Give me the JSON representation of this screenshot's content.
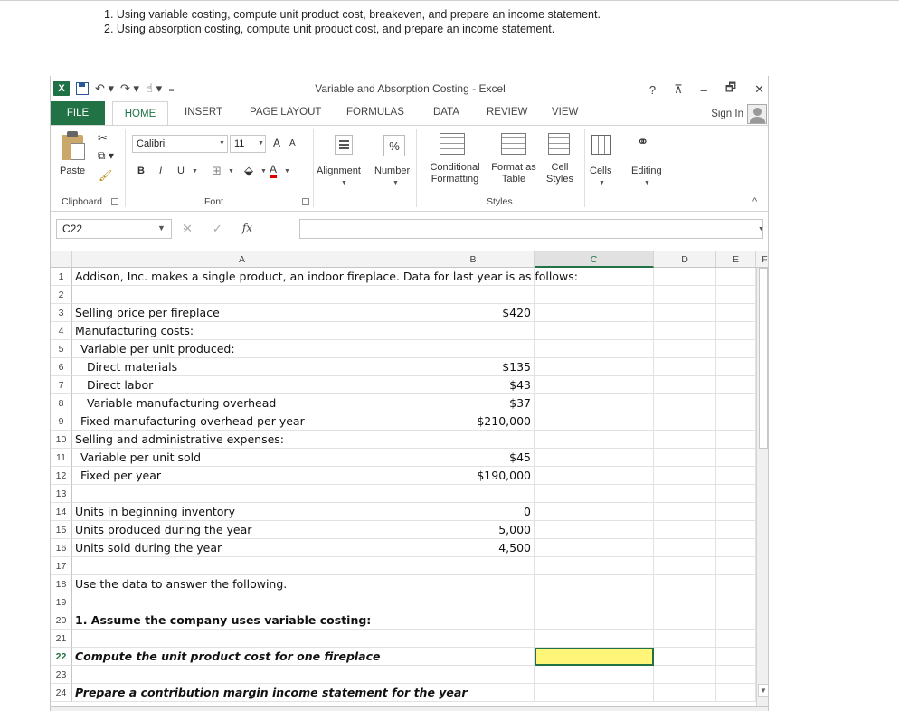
{
  "instructions": [
    "1. Using variable costing, compute unit product cost, breakeven, and prepare an income statement.",
    "2. Using absorption costing, compute unit product cost, and prepare an income statement."
  ],
  "window": {
    "title": "Variable and Absorption Costing - Excel",
    "help": "?",
    "minimize": "–",
    "restore": "🗗",
    "close": "✕"
  },
  "tabs": {
    "file": "FILE",
    "home": "HOME",
    "insert": "INSERT",
    "page_layout": "PAGE LAYOUT",
    "formulas": "FORMULAS",
    "data": "DATA",
    "review": "REVIEW",
    "view": "VIEW",
    "sign_in": "Sign In"
  },
  "ribbon": {
    "paste": "Paste",
    "clipboard": "Clipboard",
    "font_name": "Calibri",
    "font_size": "11",
    "grow": "A",
    "shrink": "A",
    "bold": "B",
    "italic": "I",
    "underline": "U",
    "font_color": "A",
    "font_group": "Font",
    "alignment": "Alignment",
    "number": "Number",
    "percent": "%",
    "conditional": "Conditional",
    "formatting": "Formatting",
    "format_as": "Format as",
    "table": "Table",
    "cell": "Cell",
    "styles": "Styles",
    "styles_group": "Styles",
    "cells": "Cells",
    "editing": "Editing",
    "collapse": "^"
  },
  "formula_bar": {
    "name_box": "C22",
    "cancel": "✕",
    "enter": "✓",
    "fx": "fx",
    "value": ""
  },
  "columns": [
    "A",
    "B",
    "C",
    "D",
    "E",
    "F"
  ],
  "rows": [
    {
      "n": "1",
      "a": "Addison, Inc. makes a single product, an indoor fireplace. Data for last year is as follows:",
      "b": "",
      "style": "",
      "indent": 0
    },
    {
      "n": "2",
      "a": "",
      "b": "",
      "style": "",
      "indent": 0
    },
    {
      "n": "3",
      "a": "Selling price per fireplace",
      "b": "$420",
      "style": "",
      "indent": 0
    },
    {
      "n": "4",
      "a": "Manufacturing costs:",
      "b": "",
      "style": "",
      "indent": 0
    },
    {
      "n": "5",
      "a": "Variable per unit produced:",
      "b": "",
      "style": "",
      "indent": 1
    },
    {
      "n": "6",
      "a": "Direct materials",
      "b": "$135",
      "style": "",
      "indent": 2
    },
    {
      "n": "7",
      "a": "Direct labor",
      "b": "$43",
      "style": "",
      "indent": 2
    },
    {
      "n": "8",
      "a": "Variable manufacturing overhead",
      "b": "$37",
      "style": "",
      "indent": 2
    },
    {
      "n": "9",
      "a": "Fixed manufacturing overhead per year",
      "b": "$210,000",
      "style": "",
      "indent": 1
    },
    {
      "n": "10",
      "a": "Selling and administrative expenses:",
      "b": "",
      "style": "",
      "indent": 0
    },
    {
      "n": "11",
      "a": "Variable per unit sold",
      "b": "$45",
      "style": "",
      "indent": 1
    },
    {
      "n": "12",
      "a": "Fixed per year",
      "b": "$190,000",
      "style": "",
      "indent": 1
    },
    {
      "n": "13",
      "a": "",
      "b": "",
      "style": "",
      "indent": 0
    },
    {
      "n": "14",
      "a": "Units in beginning inventory",
      "b": "0",
      "style": "",
      "indent": 0
    },
    {
      "n": "15",
      "a": "Units produced during the year",
      "b": "5,000",
      "style": "",
      "indent": 0
    },
    {
      "n": "16",
      "a": "Units sold during the year",
      "b": "4,500",
      "style": "",
      "indent": 0
    },
    {
      "n": "17",
      "a": "",
      "b": "",
      "style": "",
      "indent": 0
    },
    {
      "n": "18",
      "a": "Use the data to answer the following.",
      "b": "",
      "style": "",
      "indent": 0
    },
    {
      "n": "19",
      "a": "",
      "b": "",
      "style": "",
      "indent": 0
    },
    {
      "n": "20",
      "a": "1. Assume the company uses variable costing:",
      "b": "",
      "style": "bold",
      "indent": 0
    },
    {
      "n": "21",
      "a": "",
      "b": "",
      "style": "",
      "indent": 0
    },
    {
      "n": "22",
      "a": "Compute the unit product cost for one fireplace",
      "b": "",
      "style": "bi",
      "indent": 0
    },
    {
      "n": "23",
      "a": "",
      "b": "",
      "style": "",
      "indent": 0
    },
    {
      "n": "24",
      "a": "Prepare a contribution margin income statement for the year",
      "b": "",
      "style": "bi",
      "indent": 0
    }
  ],
  "active_cell": {
    "row": "22",
    "col": "C",
    "fill": "#fff679"
  },
  "colors": {
    "accent": "#217346"
  }
}
